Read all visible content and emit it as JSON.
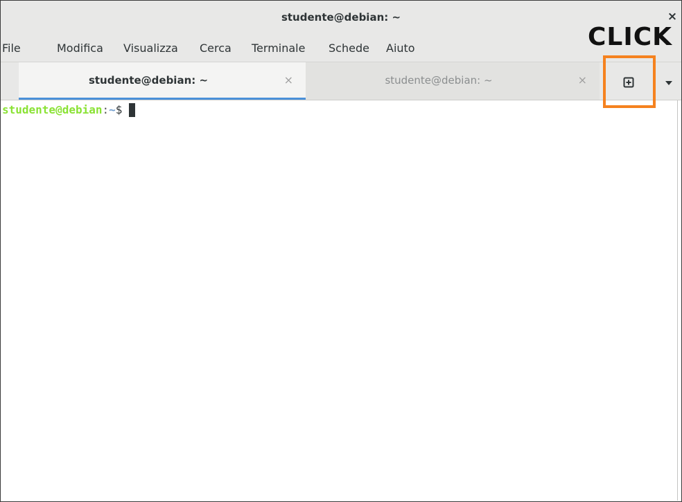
{
  "window": {
    "title": "studente@debian: ~",
    "close_glyph": "×"
  },
  "menu": [
    "File",
    "Modifica",
    "Visualizza",
    "Cerca",
    "Terminale",
    "Schede",
    "Aiuto"
  ],
  "tabs": [
    {
      "label": "studente@debian: ~",
      "close_glyph": "×",
      "active": true
    },
    {
      "label": "studente@debian: ~",
      "close_glyph": "×",
      "active": false
    }
  ],
  "toolbar": {
    "new_tab_icon": "new-tab-icon",
    "menu_icon": "chevron-down-icon"
  },
  "annotation": {
    "text": "CLICK",
    "color": "#f5821f"
  },
  "terminal": {
    "user": "studente@debian",
    "colon": ":",
    "path": "~",
    "dollar": "$ "
  },
  "colors": {
    "prompt_user": "#8ae234",
    "prompt_path": "#729fcf",
    "active_tab_underline": "#4a90d9"
  }
}
